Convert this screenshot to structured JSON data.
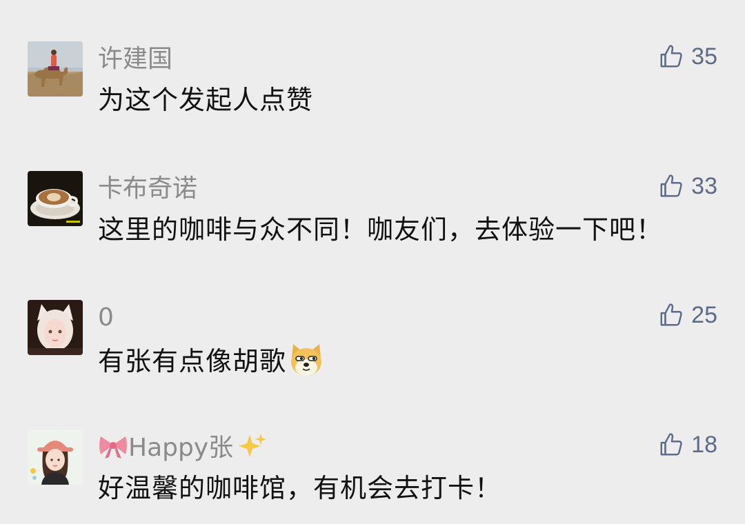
{
  "comments": [
    {
      "name": "许建国",
      "text": "为这个发起人点赞",
      "likes": "35",
      "avatar": "camel-rider-photo"
    },
    {
      "name": "卡布奇诺",
      "text": "这里的咖啡与众不同！咖友们，去体验一下吧！",
      "likes": "33",
      "avatar": "coffee-cup-photo"
    },
    {
      "name": "0",
      "text": "有张有点像胡歌",
      "likes": "25",
      "avatar": "cat-ear-girl-photo",
      "sticker": "doge-emoji"
    },
    {
      "name": "Happy张",
      "text": "好温馨的咖啡馆，有机会去打卡！",
      "likes": "18",
      "avatar": "cartoon-girl-illustration",
      "name_prefix_emoji": "ribbon-emoji",
      "name_suffix_emoji": "sparkles-emoji"
    }
  ],
  "colors": {
    "background": "#ededed",
    "name": "#8a8a8a",
    "text": "#111111",
    "like": "#5d6b8a"
  }
}
